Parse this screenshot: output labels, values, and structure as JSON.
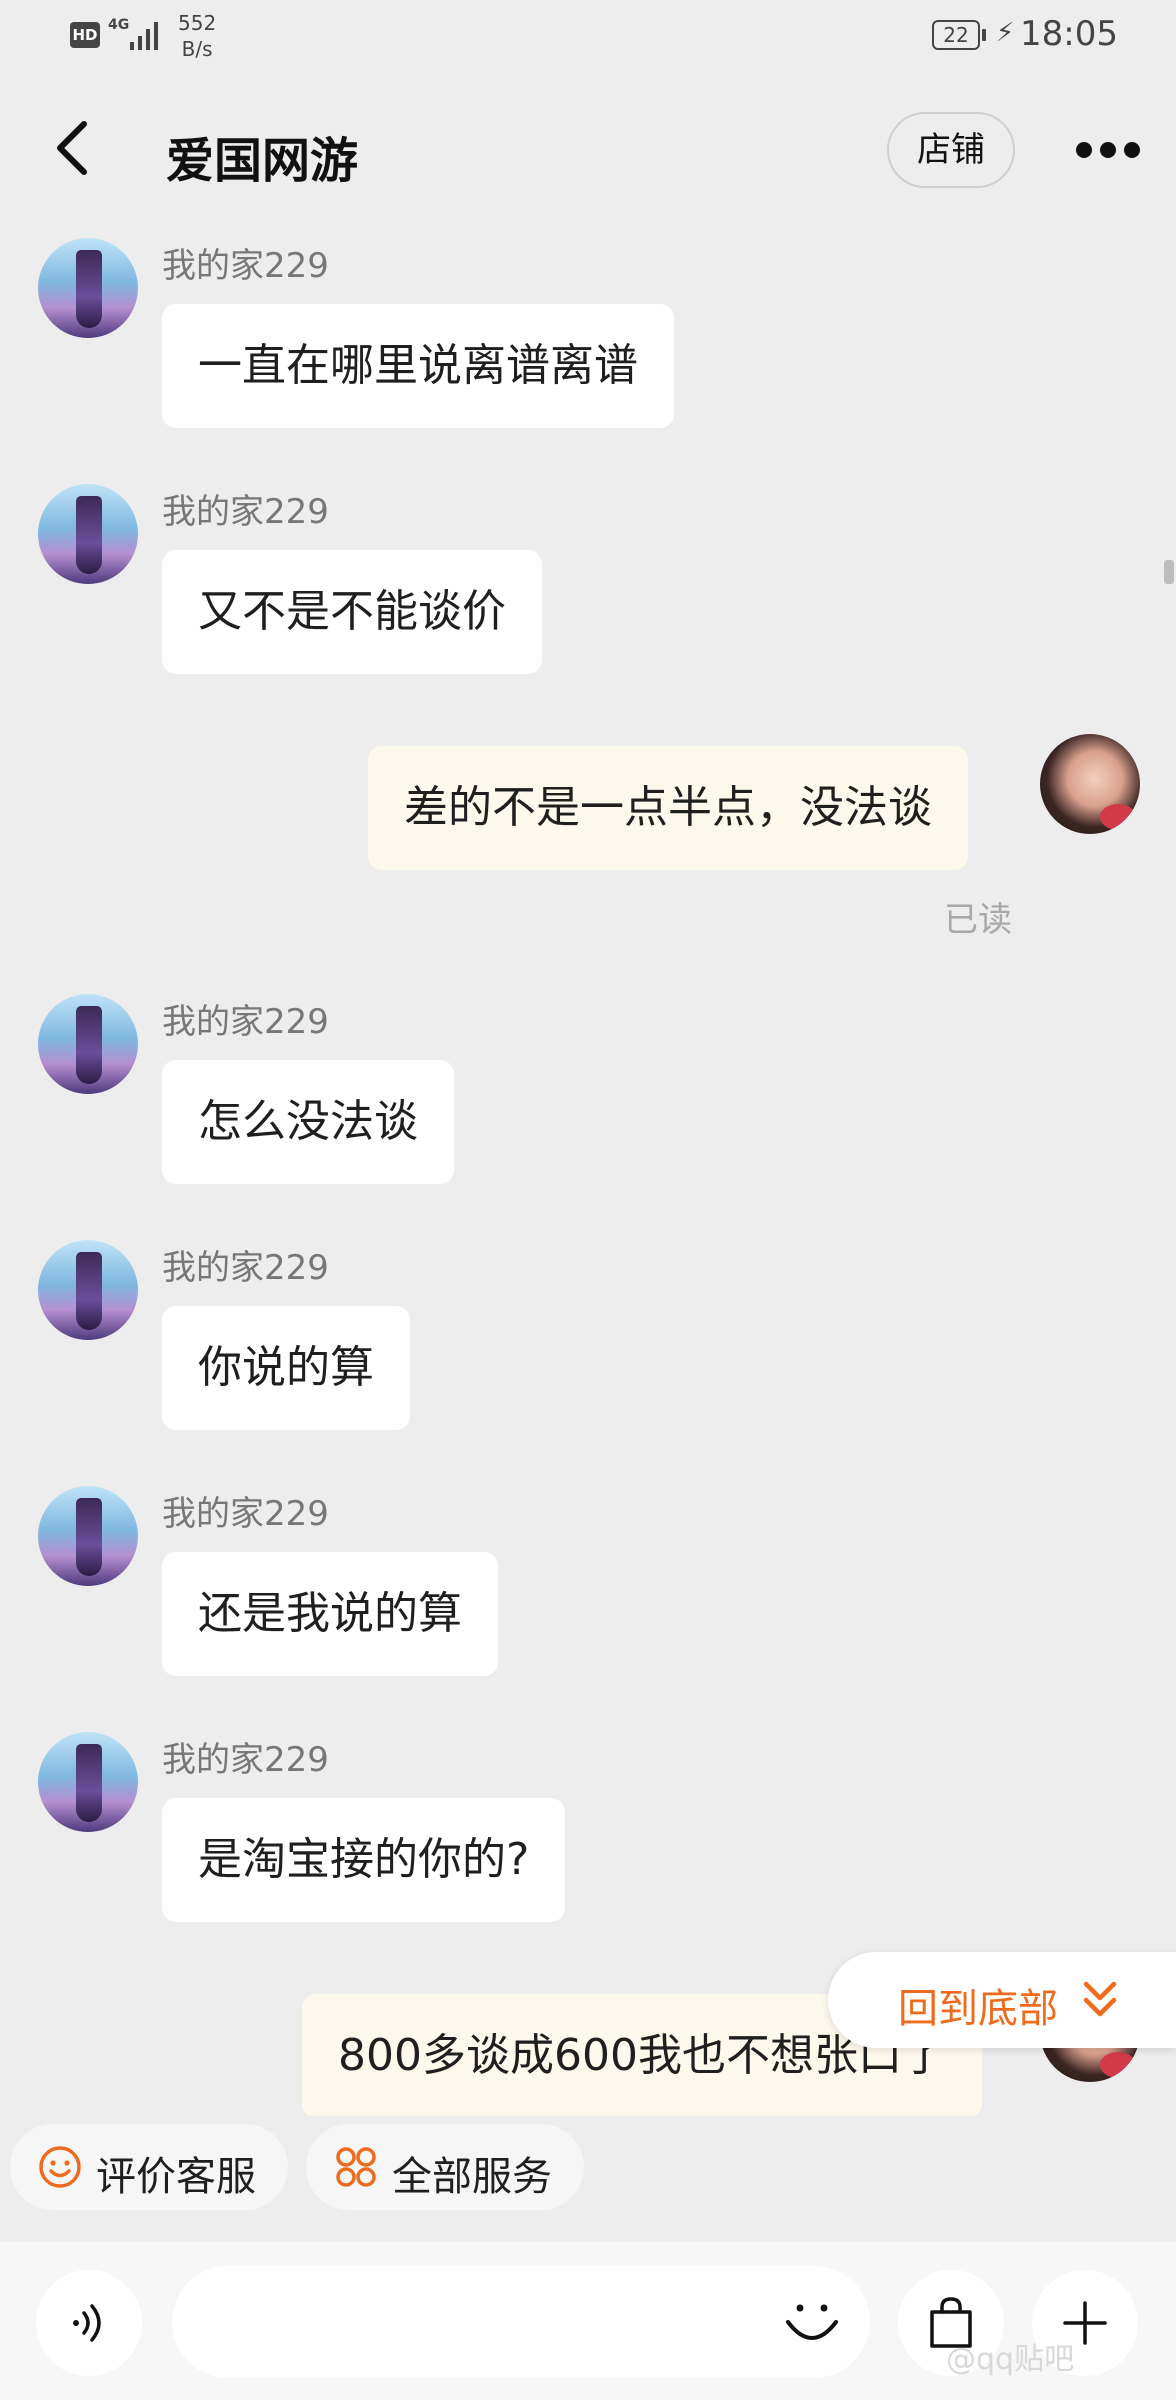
{
  "status_bar": {
    "hd": "HD",
    "network": "4G",
    "speed_value": "552",
    "speed_unit": "B/s",
    "battery": "22",
    "time": "18:05"
  },
  "header": {
    "title": "爱国网游",
    "store_label": "店铺"
  },
  "messages": [
    {
      "side": "them",
      "sender": "我的家229",
      "text": "一直在哪里说离谱离谱"
    },
    {
      "side": "them",
      "sender": "我的家229",
      "text": "又不是不能谈价"
    },
    {
      "side": "me",
      "text": "差的不是一点半点，没法谈",
      "status": "已读"
    },
    {
      "side": "them",
      "sender": "我的家229",
      "text": "怎么没法谈"
    },
    {
      "side": "them",
      "sender": "我的家229",
      "text": "你说的算"
    },
    {
      "side": "them",
      "sender": "我的家229",
      "text": "还是我说的算"
    },
    {
      "side": "them",
      "sender": "我的家229",
      "text": "是淘宝接的你的?"
    },
    {
      "side": "me",
      "text": "800多谈成600我也不想张口了"
    }
  ],
  "back_to_bottom": {
    "label": "回到底部",
    "color": "#ee6b1e"
  },
  "quick_actions": [
    {
      "label": "评价客服",
      "icon": "smiley-icon"
    },
    {
      "label": "全部服务",
      "icon": "grid-services-icon"
    }
  ],
  "input_bar": {
    "placeholder": "",
    "buttons": [
      "voice-icon",
      "emoji-icon",
      "shopping-bag-icon",
      "plus-icon"
    ]
  },
  "watermark": "@qq贴吧",
  "colors": {
    "accent": "#ee6b1e",
    "background": "#ededed",
    "bubble_them": "#ffffff",
    "bubble_me": "#fdf8ec"
  }
}
